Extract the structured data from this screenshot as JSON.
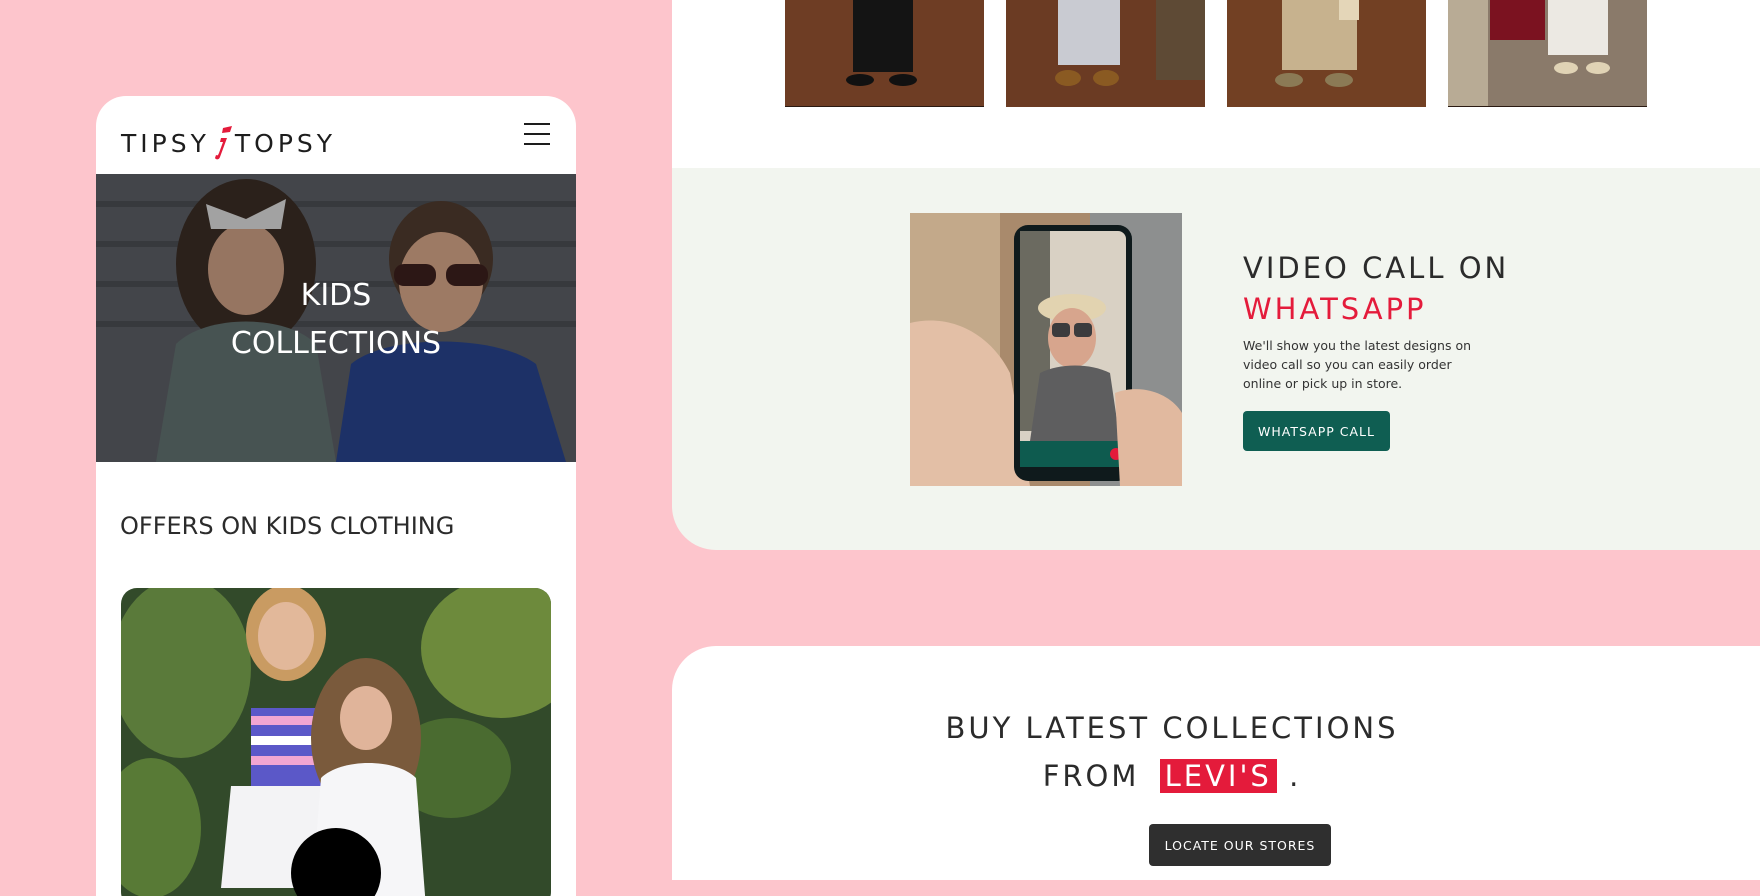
{
  "mobile": {
    "logo": {
      "left": "TIPSY",
      "mark": "i",
      "right": "TOPSY"
    },
    "hero": {
      "line1": "KIDS",
      "line2": "COLLECTIONS"
    },
    "offers_title": "OFFERS ON KIDS CLOTHING"
  },
  "video_call": {
    "heading_line1": "VIDEO CALL ON",
    "heading_line2": "WHATSAPP",
    "description": "We'll show you the latest designs on video call so you can easily order online or pick up in store.",
    "button_label": "WHATSAPP CALL"
  },
  "buy": {
    "heading_line1": "BUY LATEST COLLECTIONS",
    "heading_line2_prefix": "FROM",
    "brand": "LEVI'S",
    "heading_line2_suffix": ".",
    "button_label": "LOCATE OUR STORES"
  },
  "colors": {
    "background_pink": "#fdc5cc",
    "accent_red": "#e41b3b",
    "whatsapp_green": "#0f5e52",
    "dark_button": "#2f2f2f",
    "section_mint": "#f2f5ef"
  }
}
